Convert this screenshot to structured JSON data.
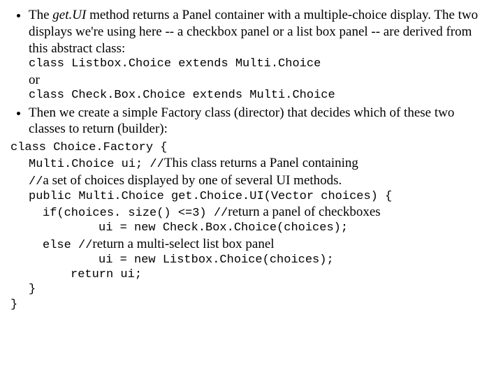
{
  "bullet1": {
    "text_a": "The ",
    "method": "get.UI",
    "text_b": " method returns a Panel container with a multiple-choice display. The two displays we're using here -- a checkbox panel or a list box panel -- are derived from this abstract class:",
    "code1": "class Listbox.Choice extends Multi.Choice",
    "or": "or",
    "code2": "class Check.Box.Choice extends Multi.Choice"
  },
  "bullet2": {
    "text": "Then we create a simple Factory class (director) that decides which of these two classes to return (builder):"
  },
  "code": {
    "l1": "class Choice.Factory {",
    "l2a": "Multi.Choice ui; //",
    "l2b": "This class returns a Panel containing",
    "l3a": "//",
    "l3b": "a set of choices displayed by one of several UI methods.",
    "l4": "public Multi.Choice get.Choice.UI(Vector choices) {",
    "l5a": "if(choices. size() <=3)",
    "l5sp": "   ",
    "l5b": "//",
    "l5c": "return a panel of checkboxes",
    "l6": "ui = new Check.Box.Choice(choices);",
    "l7a": "else",
    "l7sp": "   ",
    "l7b": "//",
    "l7c": "return a multi-select list box panel",
    "l8": "ui = new Listbox.Choice(choices);",
    "l9": "return ui;",
    "l10": "}",
    "l11": "}"
  }
}
